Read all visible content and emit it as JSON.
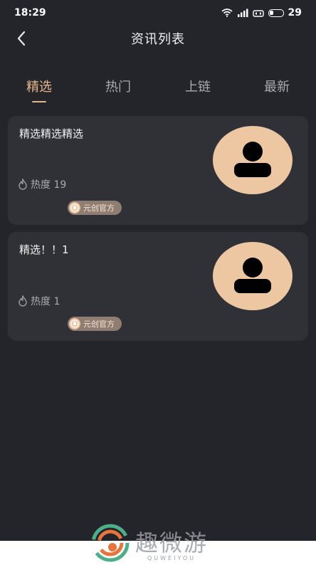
{
  "status_bar": {
    "time": "18:29",
    "battery_level": "29"
  },
  "header": {
    "title": "资讯列表"
  },
  "tabs": [
    {
      "label": "精选",
      "active": true
    },
    {
      "label": "热门",
      "active": false
    },
    {
      "label": "上链",
      "active": false
    },
    {
      "label": "最新",
      "active": false
    }
  ],
  "cards": [
    {
      "title": "精选精选精选",
      "heat": "热度 19",
      "badge": "元创官方"
    },
    {
      "title": "精选！！1",
      "heat": "热度 1",
      "badge": "元创官方"
    }
  ],
  "watermark": {
    "name": "趣微游",
    "sub": "QUWEIYOU"
  },
  "colors": {
    "background": "#23252a",
    "card": "#2f3136",
    "accent": "#e8b58a",
    "avatar": "#ecc7a2"
  }
}
